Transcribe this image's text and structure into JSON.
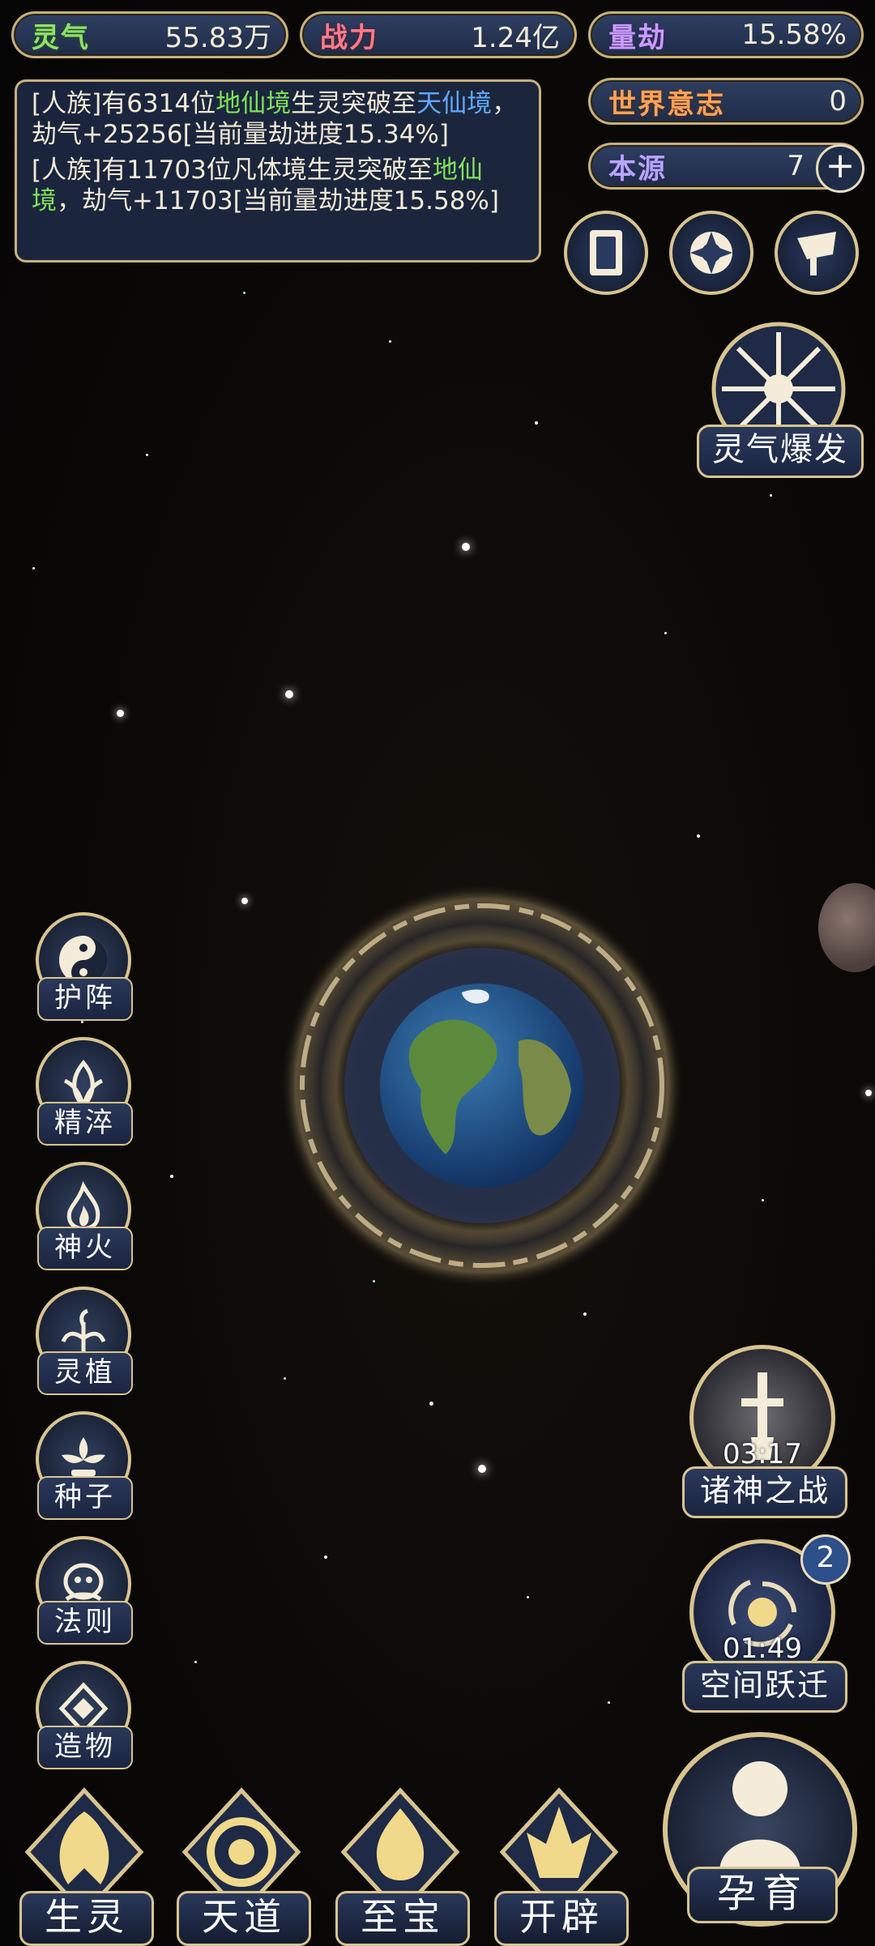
{
  "resources": {
    "lingqi": {
      "label": "灵气",
      "value": "55.83万"
    },
    "zhanli": {
      "label": "战力",
      "value": "1.24亿"
    },
    "lianjie": {
      "label": "量劫",
      "value": "15.58%"
    },
    "world_will": {
      "label": "世界意志",
      "value": "0"
    },
    "origin": {
      "label": "本源",
      "value": "7",
      "plus": "+"
    }
  },
  "log": {
    "line1": {
      "a": "[人族]有6314位",
      "b": "地仙境",
      "c": "生灵突破至",
      "d": "天仙境",
      "e": "，劫气+25256[当前量劫进度15.34%]"
    },
    "line2": {
      "a": "[人族]有11703位凡体境生灵突破至",
      "b": "地仙境",
      "c": "，劫气+11703[当前量劫进度15.58%]"
    }
  },
  "top_icons": [
    "card-icon",
    "vortex-icon",
    "flag-icon"
  ],
  "burst": {
    "label": "灵气爆发"
  },
  "side_menu": [
    {
      "label": "护阵",
      "icon": "yin-yang-icon"
    },
    {
      "label": "精淬",
      "icon": "lotus-flame-icon"
    },
    {
      "label": "神火",
      "icon": "divine-fire-icon"
    },
    {
      "label": "灵植",
      "icon": "spirit-plant-icon"
    },
    {
      "label": "种子",
      "icon": "seed-icon"
    },
    {
      "label": "法则",
      "icon": "law-icon"
    },
    {
      "label": "造物",
      "icon": "creation-icon"
    }
  ],
  "events": {
    "gods_war": {
      "label": "诸神之战",
      "timer": "03:17"
    },
    "space_jump": {
      "label": "空间跃迁",
      "timer": "01:49",
      "badge": "2"
    }
  },
  "bottom_nav": [
    {
      "label": "生灵",
      "icon": "phoenix-icon"
    },
    {
      "label": "天道",
      "icon": "cloud-swirl-icon"
    },
    {
      "label": "至宝",
      "icon": "treasure-flame-icon"
    },
    {
      "label": "开辟",
      "icon": "creation-flame-icon"
    }
  ],
  "breed": {
    "label": "孕育"
  }
}
